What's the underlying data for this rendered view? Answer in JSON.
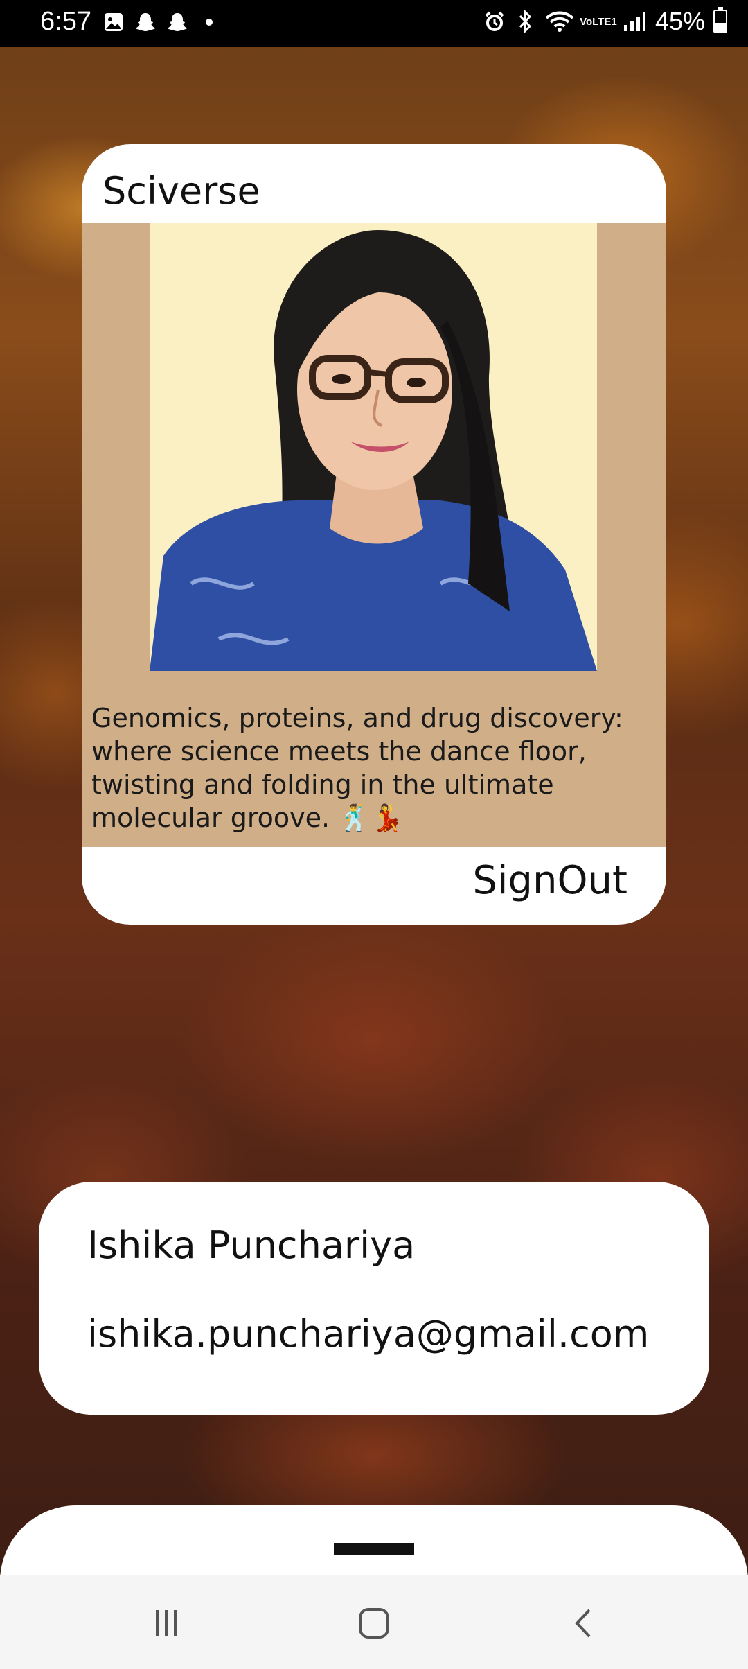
{
  "status_bar": {
    "time": "6:57",
    "battery_percent": "45%",
    "battery_level": 0.45,
    "left_icons": [
      "gallery-icon",
      "snapchat-icon",
      "snapchat-icon",
      "dot-icon"
    ],
    "right_icons": [
      "alarm-icon",
      "bluetooth-icon",
      "wifi-icon",
      "volte-icon",
      "signal-icon",
      "battery-icon"
    ],
    "volte_text": "VoLTE1"
  },
  "card": {
    "title": "Sciverse",
    "caption": "Genomics, proteins, and drug discovery: where science meets the dance floor, twisting and folding in the ultimate molecular groove. 🕺💃",
    "signout_label": "SignOut",
    "colors": {
      "body": "#cfae88",
      "background": "#ffffff"
    }
  },
  "user": {
    "name": "Ishika Punchariya",
    "email": "ishika.punchariya@gmail.com"
  },
  "nav": {
    "buttons": [
      "recents-icon",
      "home-icon",
      "back-icon"
    ]
  }
}
